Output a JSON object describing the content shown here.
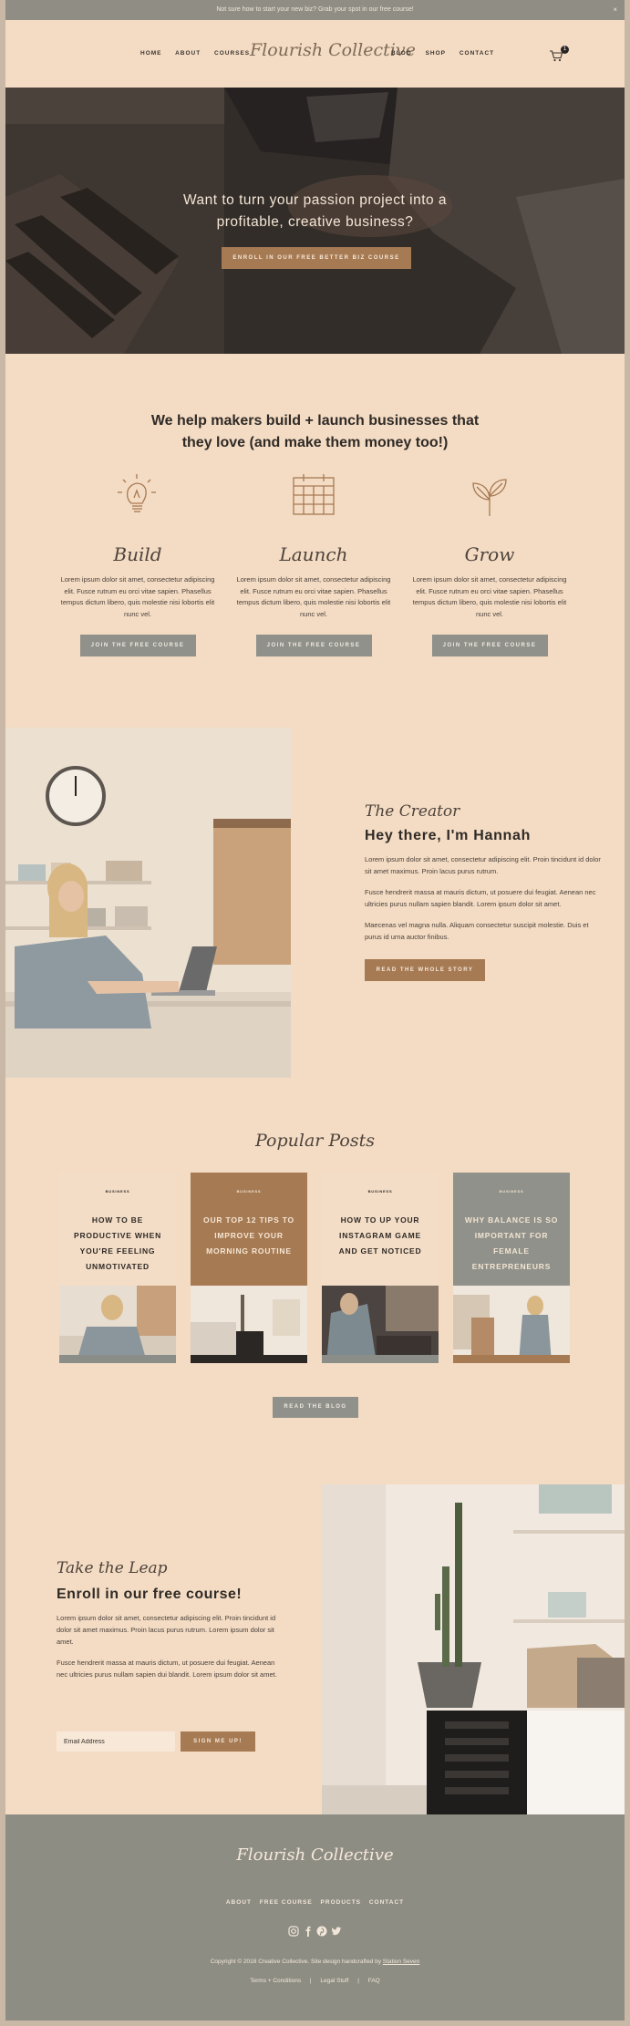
{
  "announcement": {
    "text": "Not sure how to start your new biz? Grab your spot in our free course!",
    "close": "×"
  },
  "nav": {
    "left_links": [
      "HOME",
      "ABOUT",
      "COURSES"
    ],
    "logo": "Flourish Collective",
    "right_links": [
      "BLOG",
      "SHOP",
      "CONTACT"
    ],
    "cart_count": "1"
  },
  "hero": {
    "headline_line1": "Want to turn your passion project into a",
    "headline_line2": "profitable, creative business?",
    "cta": "ENROLL IN OUR FREE BETTER BIZ COURSE"
  },
  "intro": {
    "headline_line1": "We help makers build + launch businesses that",
    "headline_line2": "they love (and make them money too!)",
    "columns": [
      {
        "icon": "lightbulb-icon",
        "title": "Build",
        "body": "Lorem ipsum dolor sit amet, consectetur adipiscing elit. Fusce rutrum eu orci vitae sapien. Phasellus tempus dictum libero, quis molestie nisi lobortis elit nunc vel.",
        "button": "JOIN THE FREE COURSE"
      },
      {
        "icon": "calendar-icon",
        "title": "Launch",
        "body": "Lorem ipsum dolor sit amet, consectetur adipiscing elit. Fusce rutrum eu orci vitae sapien. Phasellus tempus dictum libero, quis molestie nisi lobortis elit nunc vel.",
        "button": "JOIN THE FREE COURSE"
      },
      {
        "icon": "sprout-icon",
        "title": "Grow",
        "body": "Lorem ipsum dolor sit amet, consectetur adipiscing elit. Fusce rutrum eu orci vitae sapien. Phasellus tempus dictum libero, quis molestie nisi lobortis elit nunc vel.",
        "button": "JOIN THE FREE COURSE"
      }
    ]
  },
  "about": {
    "script": "The Creator",
    "heading": "Hey there, I'm Hannah",
    "p1": "Lorem ipsum dolor sit amet, consectetur adipiscing elit. Proin tincidunt id dolor sit amet maximus. Proin lacus purus rutrum.",
    "p2": "Fusce hendrerit massa at mauris dictum, ut posuere dui feugiat. Aenean nec ultricies purus nullam sapien blandit. Lorem ipsum dolor sit amet.",
    "p3": "Maecenas vel magna nulla. Aliquam consectetur suscipit molestie. Duis et purus id urna auctor finibus.",
    "button": "READ THE WHOLE STORY"
  },
  "posts": {
    "heading": "Popular Posts",
    "button": "READ THE BLOG",
    "cards": [
      {
        "badge": "BUSINESS",
        "title": "HOW TO BE PRODUCTIVE WHEN YOU'RE FEELING UNMOTIVATED"
      },
      {
        "badge": "BUSINESS",
        "title": "OUR TOP 12 TIPS TO IMPROVE YOUR MORNING ROUTINE"
      },
      {
        "badge": "BUSINESS",
        "title": "HOW TO UP YOUR INSTAGRAM GAME AND GET NOTICED"
      },
      {
        "badge": "BUSINESS",
        "title": "WHY BALANCE IS SO IMPORTANT FOR FEMALE ENTREPRENEURS"
      }
    ]
  },
  "leap": {
    "script": "Take the Leap",
    "heading": "Enroll in our free course!",
    "p1": "Lorem ipsum dolor sit amet, consectetur adipiscing elit. Proin tincidunt id dolor sit amet maximus. Proin lacus purus rutrum. Lorem ipsum dolor sit amet.",
    "p2": "Fusce hendrerit massa at mauris dictum, ut posuere dui feugiat. Aenean nec ultricies purus nullam sapien dui blandit. Lorem ipsum dolor sit amet.",
    "email_placeholder": "Email Address",
    "button": "SIGN ME UP!"
  },
  "footer": {
    "logo": "Flourish Collective",
    "links": [
      "ABOUT",
      "FREE COURSE",
      "PRODUCTS",
      "CONTACT"
    ],
    "social": [
      "instagram-icon",
      "facebook-icon",
      "pinterest-icon",
      "twitter-icon"
    ],
    "copyright_prefix": "Copyright © 2018 Creative Collective. Site design handcrafted by ",
    "copyright_link": "Station Seven",
    "legal": [
      "Terms + Conditions",
      "|",
      "Legal Stuff",
      "|",
      "FAQ"
    ]
  },
  "colors": {
    "background": "#f4dcc4",
    "accent_brown": "#a67a53",
    "accent_gray": "#8f918a",
    "footer": "#8e8d84"
  }
}
